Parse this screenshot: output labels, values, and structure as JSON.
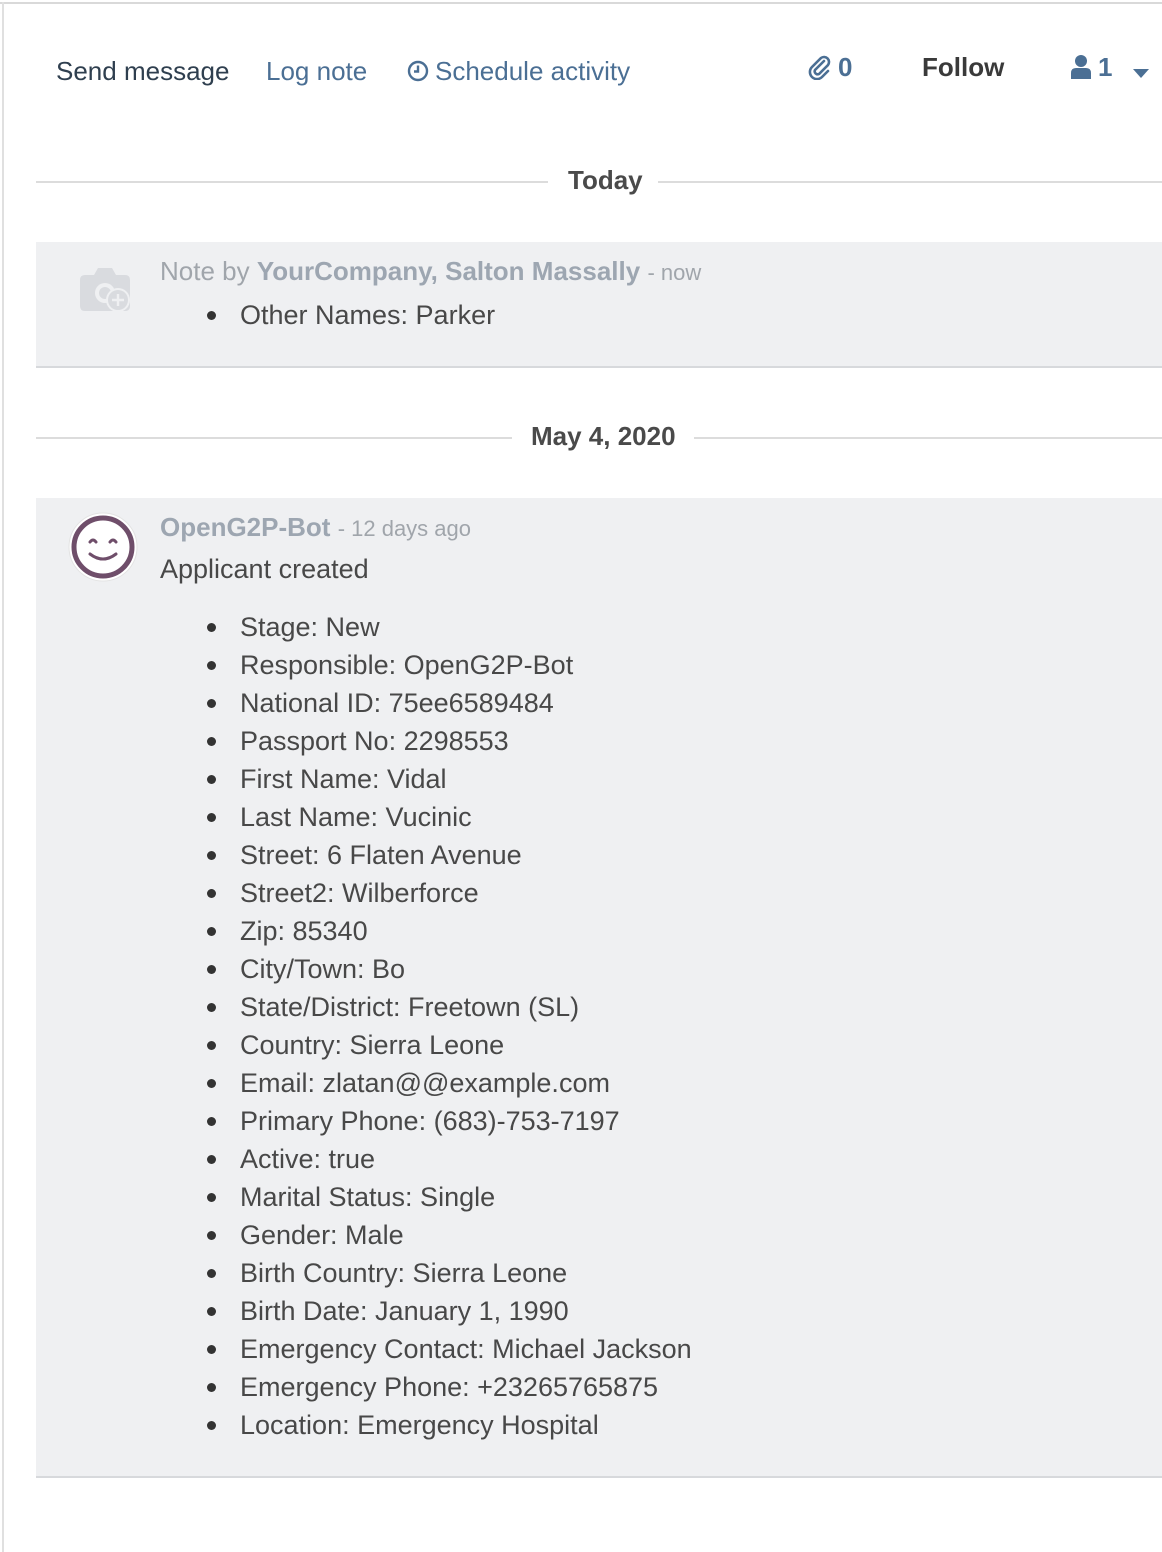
{
  "toolbar": {
    "send_message": "Send message",
    "log_note": "Log note",
    "schedule_activity": "Schedule activity",
    "attachments_count": "0",
    "follow": "Follow",
    "followers_count": "1"
  },
  "icons": {
    "clock": "clock-icon",
    "paperclip": "paperclip-icon",
    "user": "user-icon",
    "caret": "caret-down-icon",
    "camera_placeholder": "camera-plus-icon",
    "bot_avatar": "smiley-avatar-icon"
  },
  "colors": {
    "link": "#4b6f94",
    "message_bg": "#eff0f2",
    "bot_avatar_ring": "#6f4e6a"
  },
  "separators": {
    "today": "Today",
    "older": "May 4, 2020"
  },
  "messages": [
    {
      "prefix": "Note by",
      "author": "YourCompany, Salton Massally",
      "time": "- now",
      "tracking": [
        "Other Names: Parker"
      ]
    },
    {
      "prefix": "",
      "author": "OpenG2P-Bot",
      "time": "- 12 days ago",
      "body": "Applicant created",
      "tracking": [
        "Stage: New",
        "Responsible: OpenG2P-Bot",
        "National ID: 75ee6589484",
        "Passport No: 2298553",
        "First Name: Vidal",
        "Last Name: Vucinic",
        "Street: 6 Flaten Avenue",
        "Street2: Wilberforce",
        "Zip: 85340",
        "City/Town: Bo",
        "State/District: Freetown (SL)",
        "Country: Sierra Leone",
        "Email: zlatan@@example.com",
        "Primary Phone: (683)-753-7197",
        "Active: true",
        "Marital Status: Single",
        "Gender: Male",
        "Birth Country: Sierra Leone",
        "Birth Date: January 1, 1990",
        "Emergency Contact: Michael Jackson",
        "Emergency Phone: +23265765875",
        "Location: Emergency Hospital"
      ]
    }
  ]
}
